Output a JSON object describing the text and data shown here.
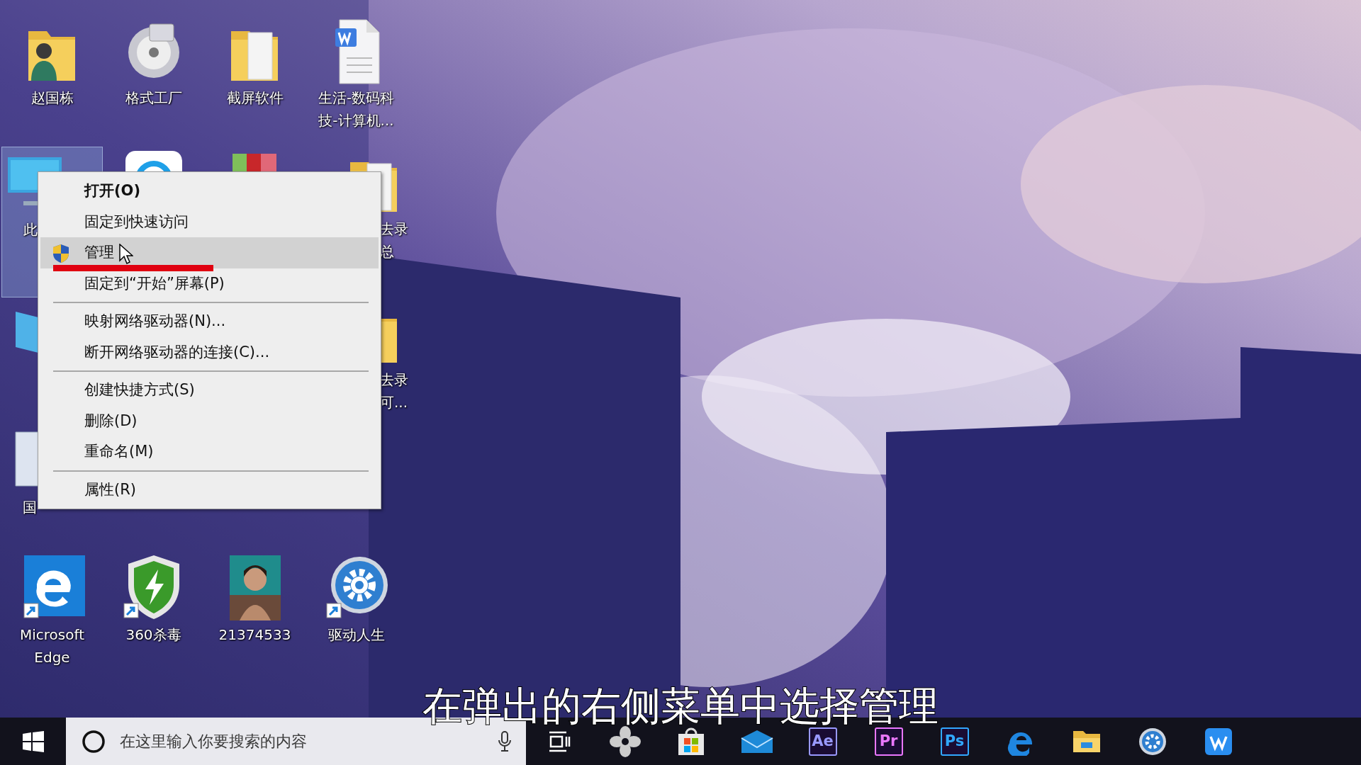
{
  "desktop_rows": [
    [
      {
        "kind": "user-folder",
        "lines": [
          "赵国栋"
        ],
        "selected": false
      },
      {
        "kind": "disc-app",
        "lines": [
          "格式工厂"
        ],
        "selected": false
      },
      {
        "kind": "folder",
        "lines": [
          "截屏软件"
        ],
        "selected": false
      },
      {
        "kind": "word-doc",
        "lines": [
          "生活-数码科",
          "技-计算机..."
        ],
        "selected": false
      }
    ],
    [
      {
        "kind": "computer",
        "lines": [
          "此"
        ],
        "selected": true
      },
      {
        "kind": "browser",
        "selected": false
      },
      {
        "kind": "books",
        "selected": false
      },
      {
        "kind": "folder",
        "lines": [
          "去录",
          "总"
        ],
        "selected": false
      }
    ],
    [
      {
        "kind": "blue-folder",
        "selected": false
      },
      {
        "kind": "folder-hidden",
        "lines": [
          "去录",
          "可..."
        ],
        "selected": false
      }
    ],
    [
      {
        "kind": "doc-peek",
        "lines": [
          "国"
        ],
        "selected": false
      }
    ],
    [
      {
        "kind": "edge",
        "lines": [
          "Microsoft",
          "Edge"
        ],
        "selected": false
      },
      {
        "kind": "shield",
        "lines": [
          "360杀毒"
        ],
        "selected": false
      },
      {
        "kind": "picture",
        "lines": [
          "21374533"
        ],
        "selected": false
      },
      {
        "kind": "gear",
        "lines": [
          "驱动人生"
        ],
        "selected": false
      }
    ]
  ],
  "context_menu": {
    "items": [
      {
        "kind": "item",
        "label": "打开(O)",
        "default": true,
        "selected": false
      },
      {
        "kind": "item",
        "label": "固定到快速访问",
        "default": false,
        "selected": false
      },
      {
        "kind": "admin-item",
        "label": "管理",
        "default": false,
        "selected": true
      },
      {
        "kind": "item",
        "label": "固定到“开始”屏幕(P)",
        "default": false,
        "selected": false
      },
      {
        "kind": "separator"
      },
      {
        "kind": "item",
        "label": "映射网络驱动器(N)...",
        "default": false,
        "selected": false
      },
      {
        "kind": "item",
        "label": "断开网络驱动器的连接(C)...",
        "default": false,
        "selected": false
      },
      {
        "kind": "separator"
      },
      {
        "kind": "item",
        "label": "创建快捷方式(S)",
        "default": false,
        "selected": false
      },
      {
        "kind": "item",
        "label": "删除(D)",
        "default": false,
        "selected": false
      },
      {
        "kind": "item",
        "label": "重命名(M)",
        "default": false,
        "selected": false
      },
      {
        "kind": "separator"
      },
      {
        "kind": "item",
        "label": "属性(R)",
        "default": false,
        "selected": false
      }
    ]
  },
  "subtitle": "在弹出的右侧菜单中选择管理",
  "taskbar": {
    "search": {
      "placeholder": "在这里输入你要搜索的内容"
    },
    "apps": [
      {
        "kind": "task-view"
      },
      {
        "kind": "pinwheel"
      },
      {
        "kind": "store"
      },
      {
        "kind": "mail"
      },
      {
        "kind": "adobe",
        "label": "Ae",
        "color": "#9999ff"
      },
      {
        "kind": "adobe",
        "label": "Pr",
        "color": "#ea77ff"
      },
      {
        "kind": "adobe",
        "label": "Ps",
        "color": "#31a8ff"
      },
      {
        "kind": "edge"
      },
      {
        "kind": "explorer"
      },
      {
        "kind": "settings"
      },
      {
        "kind": "wps"
      }
    ]
  }
}
